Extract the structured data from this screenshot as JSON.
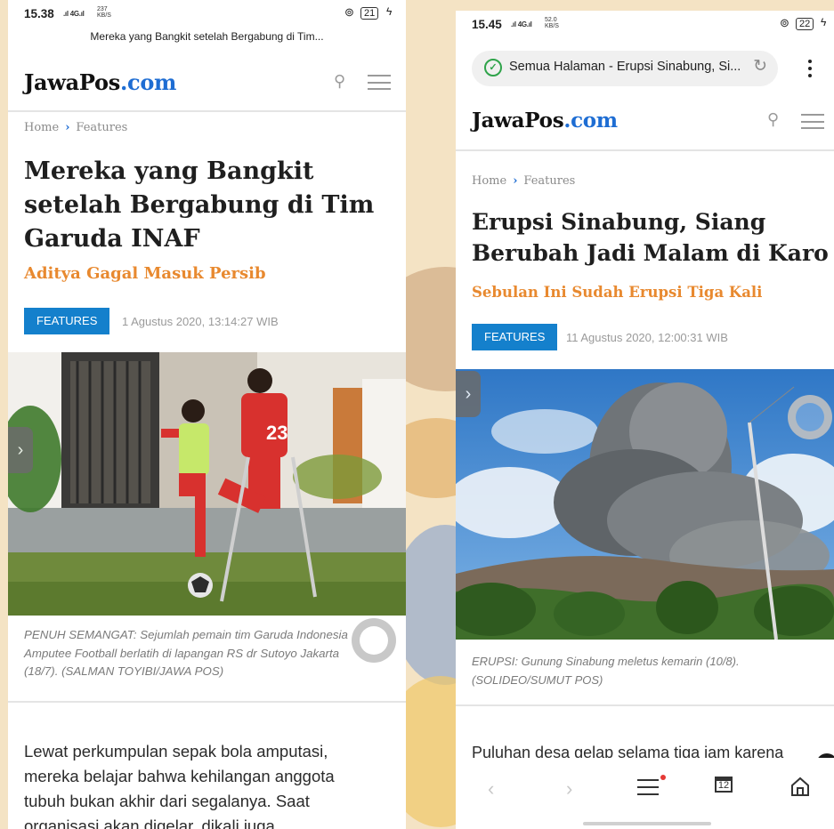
{
  "left": {
    "status": {
      "time": "15.38",
      "net": "4G",
      "kbs_top": "237",
      "kbs_bottom": "KB/S",
      "battery": "21"
    },
    "tab_title": "Mereka yang Bangkit setelah Bergabung di Tim...",
    "logo": {
      "brand": "JawaPos",
      "tld": ".com"
    },
    "breadcrumb": {
      "home": "Home",
      "sep": "›",
      "section": "Features"
    },
    "headline_lines": [
      "Mereka yang Bangkit",
      "setelah Bergabung di Tim",
      "Garuda INAF"
    ],
    "subhead": "Aditya Gagal Masuk Persib",
    "badge": "FEATURES",
    "date": "1 Agustus 2020, 13:14:27 WIB",
    "caption_lines": [
      "PENUH SEMANGAT: Sejumlah pemain tim Garuda Indonesia",
      "Amputee Football berlatih di lapangan RS dr Sutoyo Jakarta",
      "(18/7). (SALMAN TOYIBI/JAWA POS)"
    ],
    "body_lines": [
      "Lewat perkumpulan sepak bola amputasi,",
      "mereka belajar bahwa kehilangan anggota",
      "tubuh bukan akhir dari segalanya. Saat",
      "organisasi akan digelar, dikali juga"
    ],
    "jersey_number": "23"
  },
  "right": {
    "status": {
      "time": "15.45",
      "net": "4G",
      "kbs_top": "52.0",
      "kbs_bottom": "KB/S",
      "battery": "22"
    },
    "url": "Semua Halaman - Erupsi Sinabung, Si...",
    "logo": {
      "brand": "JawaPos",
      "tld": ".com"
    },
    "breadcrumb": {
      "home": "Home",
      "sep": "›",
      "section": "Features"
    },
    "headline_lines": [
      "Erupsi Sinabung, Siang",
      "Berubah Jadi Malam di Karo"
    ],
    "subhead": "Sebulan Ini Sudah Erupsi Tiga Kali",
    "badge": "FEATURES",
    "date": "11 Agustus 2020, 12:00:31 WIB",
    "caption_lines": [
      "ERUPSI: Gunung Sinabung meletus kemarin (10/8).",
      "(SOLIDEO/SUMUT POS)"
    ],
    "body_lines": [
      "Puluhan desa gelap selama tiga jam karena"
    ],
    "tab_count": "12"
  },
  "icons": {
    "search": "search-icon",
    "menu": "hamburger-menu-icon",
    "back": "back-icon",
    "forward": "forward-icon",
    "tabs": "tabs-icon",
    "home": "home-icon",
    "shield": "shield-check-icon",
    "reload": "reload-icon"
  },
  "colors": {
    "brand_blue": "#1e6dd3",
    "subhead_orange": "#e8892f",
    "badge_blue": "#1480cc",
    "shield_green": "#2fa34a"
  }
}
